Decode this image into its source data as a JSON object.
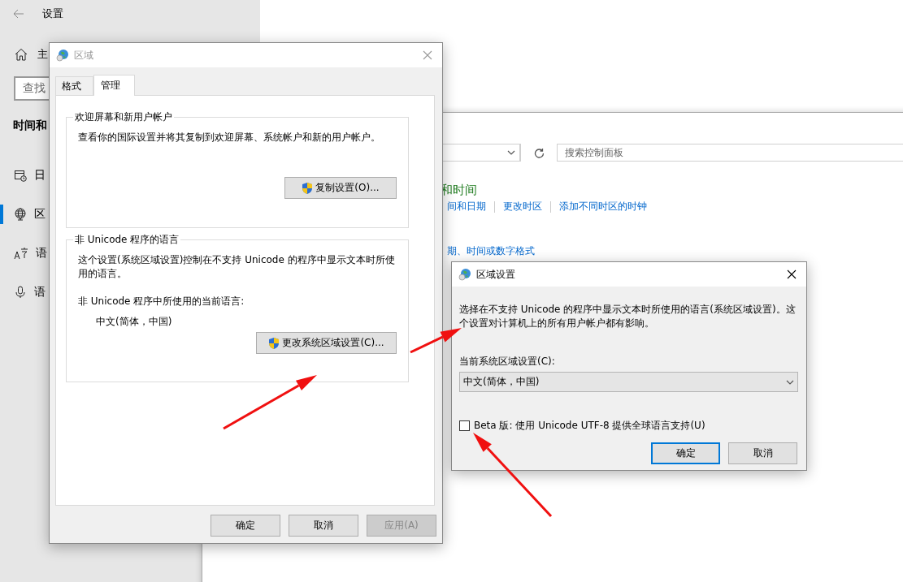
{
  "settings": {
    "title": "设置",
    "home_label": "主",
    "search": {
      "placeholder": "查找"
    },
    "section_title": "时间和",
    "nav_items": [
      {
        "label": "日",
        "selected": false
      },
      {
        "label": "区",
        "selected": true
      },
      {
        "label": "语",
        "selected": false
      },
      {
        "label": "语",
        "selected": false
      }
    ]
  },
  "control_panel": {
    "search": {
      "placeholder": "搜索控制面板"
    },
    "heading": "和时间",
    "links": [
      "间和日期",
      "更改时区",
      "添加不同时区的时钟"
    ],
    "sublink": "期、时间或数字格式"
  },
  "region_dialog": {
    "title": "区域",
    "active": false,
    "tabs": [
      {
        "label": "格式",
        "selected": false
      },
      {
        "label": "管理",
        "selected": true
      }
    ],
    "groups": [
      {
        "legend": "欢迎屏幕和新用户帐户",
        "text": "查看你的国际设置并将其复制到欢迎屏幕、系统帐户和新的用户帐户。",
        "button": "复制设置(O)..."
      },
      {
        "legend": "非 Unicode 程序的语言",
        "text": "这个设置(系统区域设置)控制在不支持 Unicode 的程序中显示文本时所使用的语言。",
        "label": "非 Unicode 程序中所使用的当前语言:",
        "value": "中文(简体，中国)",
        "button": "更改系统区域设置(C)..."
      }
    ],
    "buttons": [
      {
        "label": "确定",
        "disabled": false
      },
      {
        "label": "取消",
        "disabled": false
      },
      {
        "label": "应用(A)",
        "disabled": true
      }
    ]
  },
  "locale_dialog": {
    "title": "区域设置",
    "active": true,
    "text": "选择在不支持 Unicode 的程序中显示文本时所使用的语言(系统区域设置)。这个设置对计算机上的所有用户帐户都有影响。",
    "select_label": "当前系统区域设置(C):",
    "select_value": "中文(简体，中国)",
    "checkbox": {
      "label": "Beta 版: 使用 Unicode UTF-8 提供全球语言支持(U)",
      "checked": false
    },
    "buttons": [
      {
        "label": "确定",
        "default": true
      },
      {
        "label": "取消",
        "default": false
      }
    ]
  }
}
